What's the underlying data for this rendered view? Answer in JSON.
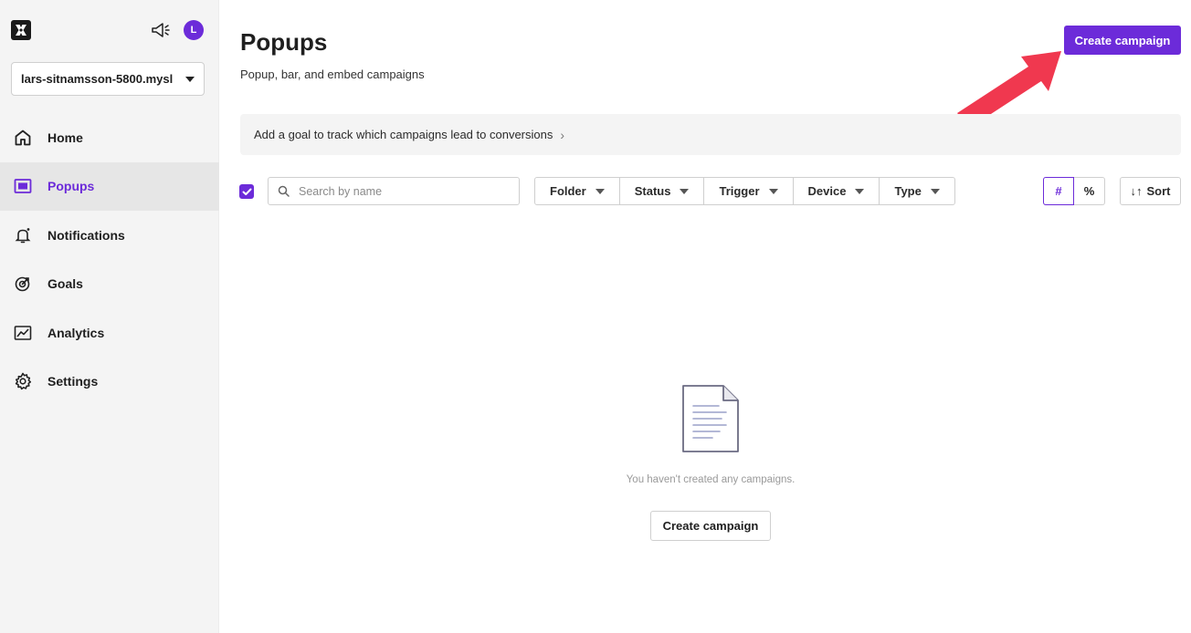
{
  "colors": {
    "accent": "#6c2bd9",
    "arrow": "#f0384f",
    "sidebar_bg": "#f4f4f4"
  },
  "header": {
    "avatar_initial": "L",
    "account": "lars-sitnamsson-5800.mysl"
  },
  "sidebar": {
    "items": [
      {
        "label": "Home",
        "icon": "home-icon"
      },
      {
        "label": "Popups",
        "icon": "popup-icon",
        "active": true
      },
      {
        "label": "Notifications",
        "icon": "bell-icon"
      },
      {
        "label": "Goals",
        "icon": "target-icon"
      },
      {
        "label": "Analytics",
        "icon": "chart-icon"
      },
      {
        "label": "Settings",
        "icon": "gear-icon"
      }
    ]
  },
  "main": {
    "title": "Popups",
    "subtitle": "Popup, bar, and embed campaigns",
    "create_button": "Create campaign",
    "goal_banner": "Add a goal to track which campaigns lead to conversions",
    "search_placeholder": "Search by name",
    "filters": [
      "Folder",
      "Status",
      "Trigger",
      "Device",
      "Type"
    ],
    "toggle": {
      "count": "#",
      "percent": "%"
    },
    "sort": "Sort",
    "empty_message": "You haven't created any campaigns.",
    "empty_button": "Create campaign"
  }
}
